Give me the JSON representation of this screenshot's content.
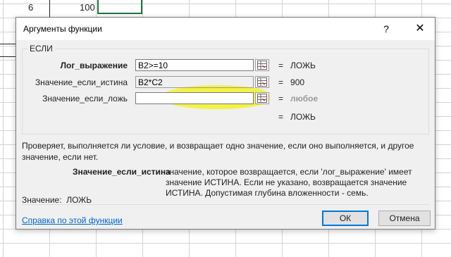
{
  "sheet": {
    "cell_a": "6",
    "cell_b": "100"
  },
  "dialog": {
    "title": "Аргументы функции",
    "help_glyph": "?",
    "close_glyph": "✕",
    "function_name": "ЕСЛИ",
    "args": [
      {
        "label": "Лог_выражение",
        "value": "B2>=10",
        "result": "ЛОЖЬ",
        "equals": "="
      },
      {
        "label": "Значение_если_истина",
        "value": "B2*C2",
        "result": "900",
        "equals": "="
      },
      {
        "label": "Значение_если_ложь",
        "value": "",
        "result": "любое",
        "equals": "="
      }
    ],
    "overall_equals": "=",
    "overall_result": "ЛОЖЬ",
    "description": "Проверяет, выполняется ли условие, и возвращает одно значение, если оно выполняется, и другое значение, если нет.",
    "param_name": "Значение_если_истина",
    "param_description": "значение, которое возвращается, если 'лог_выражение' имеет значение ИСТИНА. Если не указано, возвращается значение ИСТИНА. Допустимая глубина вложенности - семь.",
    "value_label": "Значение:",
    "value_result": "ЛОЖЬ",
    "help_link": "Справка по этой функции",
    "ok_label": "ОК",
    "cancel_label": "Отмена"
  },
  "colors": {
    "highlight": "#f2f23a",
    "link": "#0066cc",
    "accent": "#0078d7"
  },
  "icons": [
    "help-icon",
    "close-icon",
    "range-ref-icon"
  ]
}
